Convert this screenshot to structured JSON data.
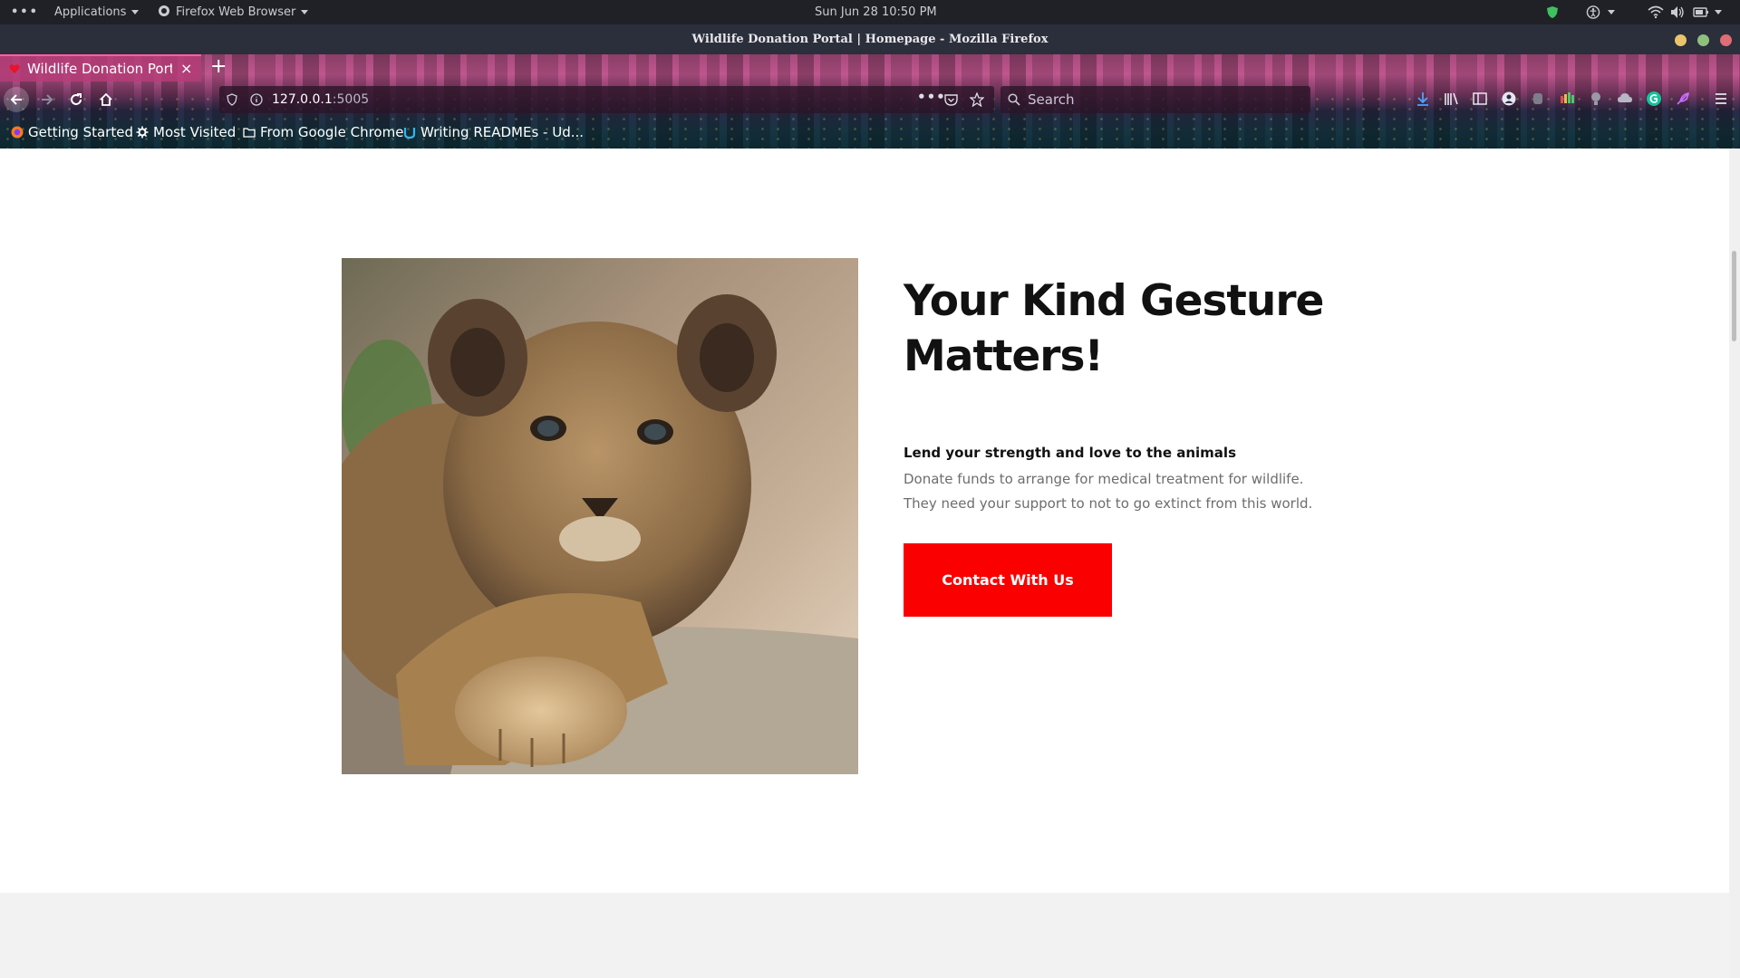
{
  "topbar": {
    "activities": "•••",
    "applications": "Applications",
    "app_name": "Firefox Web Browser",
    "clock": "Sun Jun 28  10:50 PM"
  },
  "window": {
    "title": "Wildlife Donation Portal | Homepage - Mozilla Firefox",
    "buttons": [
      {
        "name": "minimize",
        "color": "#e9c46a"
      },
      {
        "name": "maximize",
        "color": "#8fbf7f"
      },
      {
        "name": "close",
        "color": "#e06c75"
      }
    ]
  },
  "tabs": [
    {
      "label": "Wildlife Donation Porta",
      "close": "×",
      "favicon_color": "#e8142a"
    }
  ],
  "newtab_label": "+",
  "navbar": {
    "url_host": "127.0.0.1",
    "url_port": ":5005",
    "search_placeholder": "Search"
  },
  "bookmarks": [
    {
      "label": "Getting Started",
      "icon": "firefox-icon"
    },
    {
      "label": "Most Visited",
      "icon": "gear-icon"
    },
    {
      "label": "From Google Chrome",
      "icon": "folder-icon"
    },
    {
      "label": "Writing READMEs - Ud...",
      "icon": "udacity-icon"
    }
  ],
  "hero": {
    "headline": "Your Kind Gesture Matters!",
    "subheading": "Lend your strength and love to the animals",
    "description": "Donate funds to arrange for medical treatment for wildlife. They need your support to not to go extinct from this world.",
    "cta_label": "Contact With Us",
    "cta_color": "#fa0000"
  },
  "colors": {
    "accent": "#fa0000",
    "tab_highlight": "#ff5fa8"
  }
}
